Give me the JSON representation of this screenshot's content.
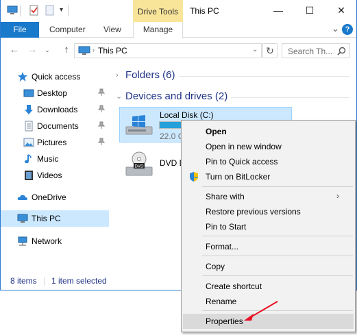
{
  "titlebar": {
    "drive_tools": "Drive Tools",
    "title": "This PC",
    "minimize": "—",
    "maximize": "☐",
    "close": "✕"
  },
  "ribbon": {
    "tabs": [
      "File",
      "Computer",
      "View",
      "Manage"
    ],
    "collapse": "⌄",
    "help": "?"
  },
  "address_bar": {
    "path": "This PC",
    "search_placeholder": "Search Th..."
  },
  "sidebar": {
    "items": [
      {
        "label": "Quick access",
        "icon": "star-icon"
      },
      {
        "label": "Desktop",
        "icon": "desktop-folder-icon",
        "pinned": true
      },
      {
        "label": "Downloads",
        "icon": "downloads-folder-icon",
        "pinned": true
      },
      {
        "label": "Documents",
        "icon": "documents-folder-icon",
        "pinned": true
      },
      {
        "label": "Pictures",
        "icon": "pictures-folder-icon",
        "pinned": true
      },
      {
        "label": "Music",
        "icon": "music-icon"
      },
      {
        "label": "Videos",
        "icon": "videos-icon"
      },
      {
        "label": "OneDrive",
        "icon": "onedrive-icon"
      },
      {
        "label": "This PC",
        "icon": "this-pc-icon",
        "selected": true
      },
      {
        "label": "Network",
        "icon": "network-icon"
      }
    ]
  },
  "content": {
    "folders_group": "Folders (6)",
    "devices_group": "Devices and drives (2)",
    "drive_c": {
      "name": "Local Disk (C:)",
      "size_text": "22.0 G",
      "used_fraction": 0.42
    },
    "dvd": {
      "name": "DVD D"
    }
  },
  "status": {
    "items_count": "8 items",
    "selected": "1 item selected"
  },
  "context_menu": {
    "items": [
      "Open",
      "Open in new window",
      "Pin to Quick access",
      "Turn on BitLocker",
      "Share with",
      "Restore previous versions",
      "Pin to Start",
      "Format...",
      "Copy",
      "Create shortcut",
      "Rename",
      "Properties"
    ]
  },
  "colors": {
    "accent": "#1979ca",
    "drive_tools": "#f9e59a",
    "selection": "#cce8ff",
    "annotation_arrow": "#e81123"
  }
}
